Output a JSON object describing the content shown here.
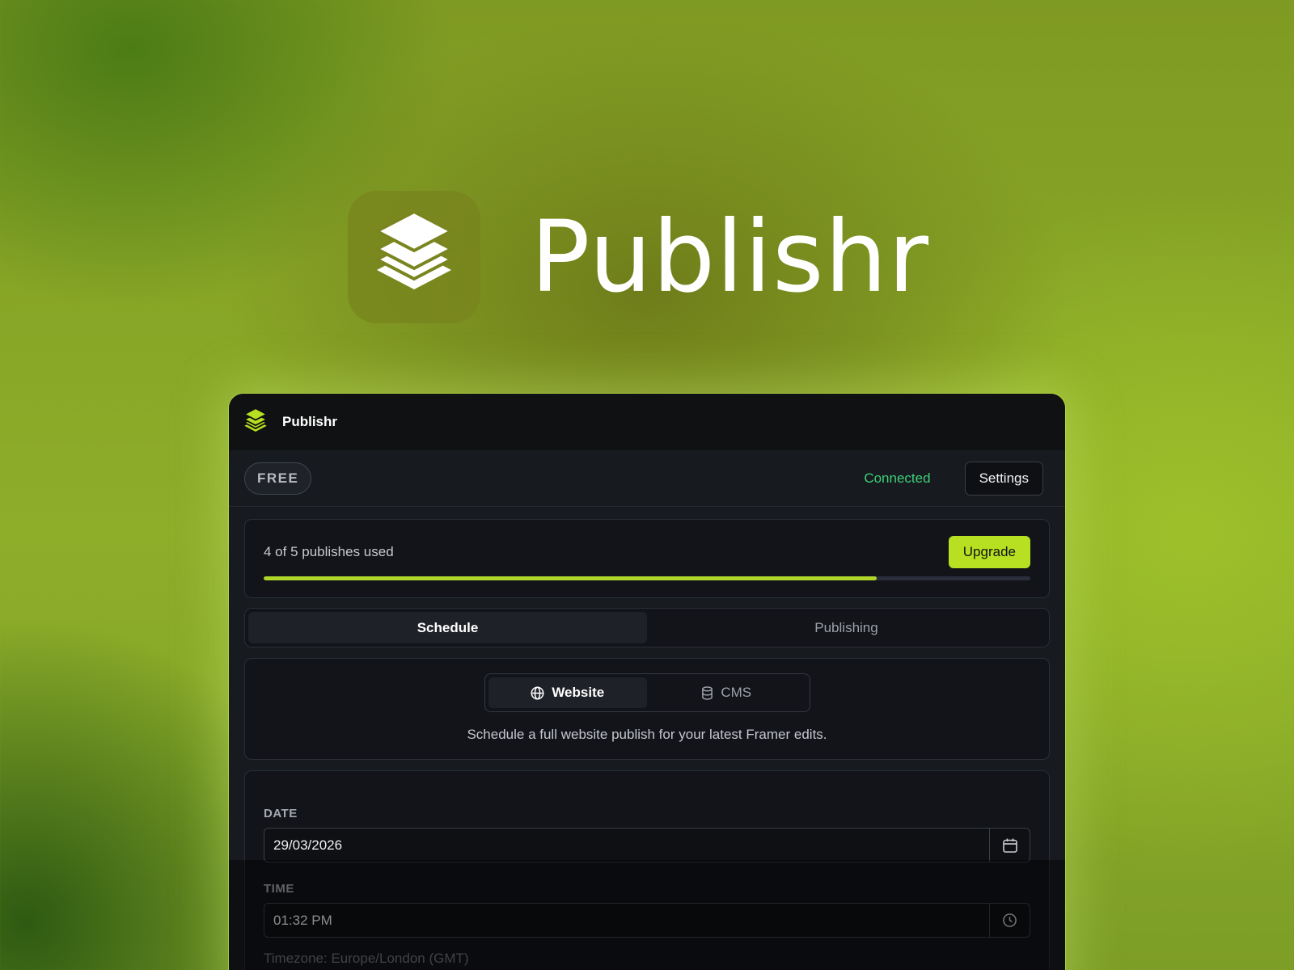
{
  "hero": {
    "title": "Publishr",
    "icon": "layers-stack-icon"
  },
  "window": {
    "app_name": "Publishr",
    "icon": "layers-stack-icon",
    "accent_color": "#b6e021"
  },
  "toolbar": {
    "plan_badge": "FREE",
    "status": "Connected",
    "status_color": "#3ecf79",
    "settings_label": "Settings"
  },
  "usage": {
    "text": "4 of 5 publishes used",
    "used": 4,
    "limit": 5,
    "upgrade_label": "Upgrade"
  },
  "tabs": [
    {
      "label": "Schedule",
      "active": true
    },
    {
      "label": "Publishing",
      "active": false
    }
  ],
  "mode": {
    "options": [
      {
        "label": "Website",
        "icon": "globe-icon",
        "active": true
      },
      {
        "label": "CMS",
        "icon": "database-icon",
        "active": false
      }
    ],
    "description": "Schedule a full website publish for your latest Framer edits."
  },
  "form": {
    "date_label": "DATE",
    "date_value": "29/03/2026",
    "time_label": "TIME",
    "time_value": "01:32 PM",
    "timezone": "Timezone: Europe/London (GMT)"
  }
}
